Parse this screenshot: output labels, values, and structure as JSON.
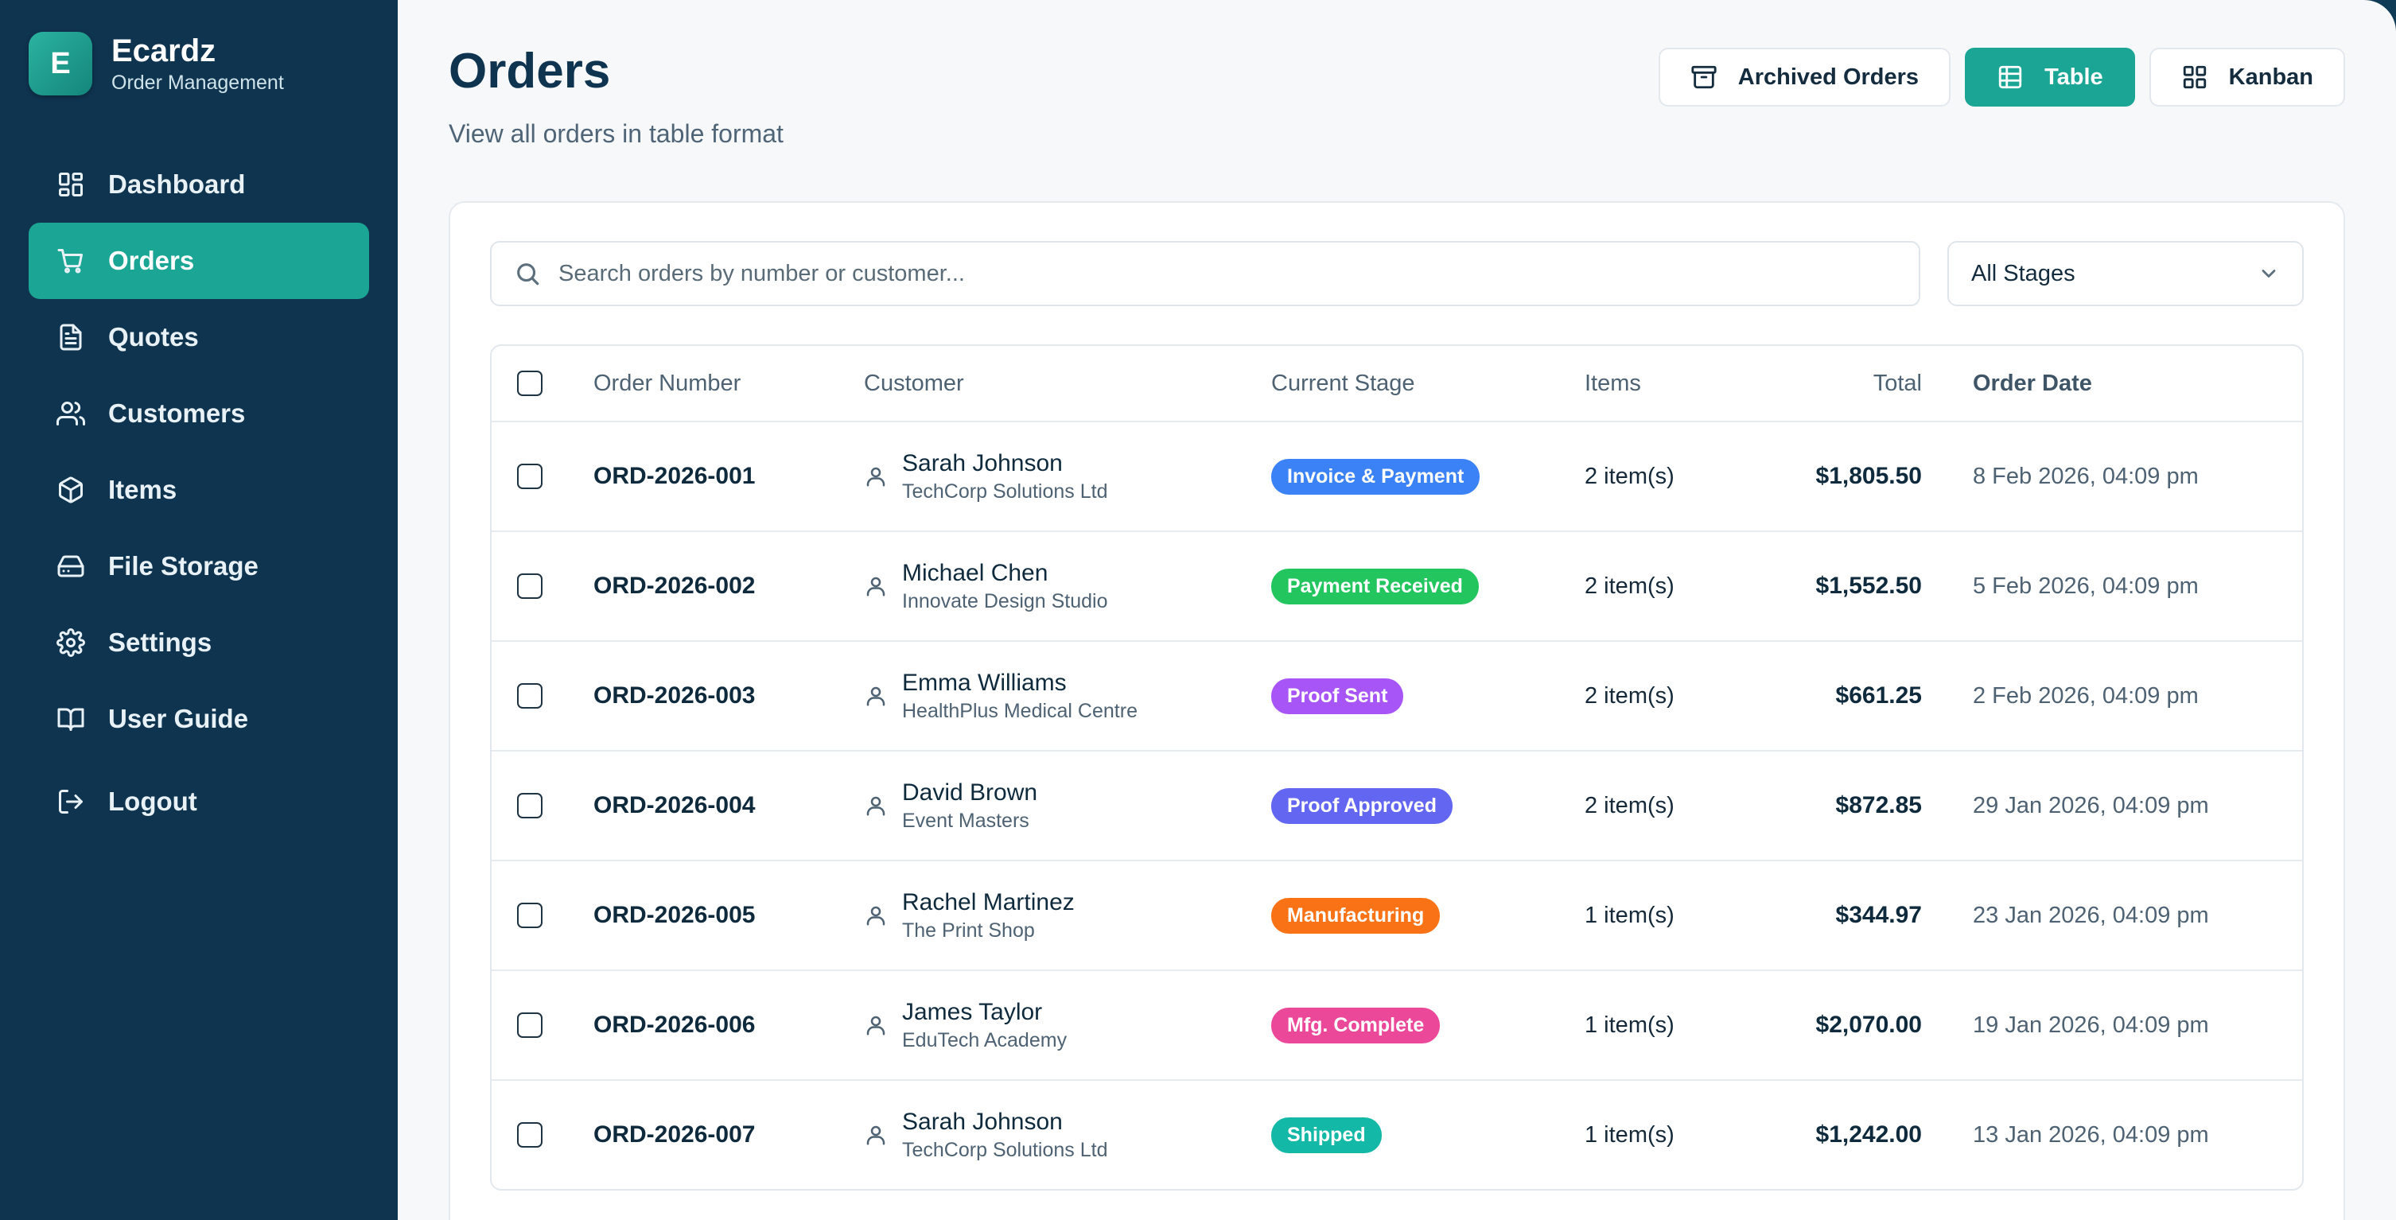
{
  "brand": {
    "logo_letter": "E",
    "name": "Ecardz",
    "subtitle": "Order Management"
  },
  "sidebar": {
    "items": [
      {
        "label": "Dashboard",
        "icon": "dashboard-icon"
      },
      {
        "label": "Orders",
        "icon": "cart-icon",
        "active": true
      },
      {
        "label": "Quotes",
        "icon": "document-icon"
      },
      {
        "label": "Customers",
        "icon": "users-icon"
      },
      {
        "label": "Items",
        "icon": "box-icon"
      },
      {
        "label": "File Storage",
        "icon": "storage-icon"
      },
      {
        "label": "Settings",
        "icon": "gear-icon"
      },
      {
        "label": "User Guide",
        "icon": "book-icon"
      }
    ],
    "logout": "Logout"
  },
  "header": {
    "title": "Orders",
    "subtitle": "View all orders in table format",
    "archived_label": "Archived Orders",
    "table_label": "Table",
    "kanban_label": "Kanban"
  },
  "filters": {
    "search_placeholder": "Search orders by number or customer...",
    "stage_selected": "All Stages"
  },
  "table": {
    "columns": [
      "Order Number",
      "Customer",
      "Current Stage",
      "Items",
      "Total",
      "Order Date"
    ],
    "rows": [
      {
        "number": "ORD-2026-001",
        "customer": "Sarah Johnson",
        "company": "TechCorp Solutions Ltd",
        "stage": "Invoice & Payment",
        "stage_color": "#3b82f6",
        "items": "2 item(s)",
        "total": "$1,805.50",
        "date": "8 Feb 2026, 04:09 pm"
      },
      {
        "number": "ORD-2026-002",
        "customer": "Michael Chen",
        "company": "Innovate Design Studio",
        "stage": "Payment Received",
        "stage_color": "#22c55e",
        "items": "2 item(s)",
        "total": "$1,552.50",
        "date": "5 Feb 2026, 04:09 pm"
      },
      {
        "number": "ORD-2026-003",
        "customer": "Emma Williams",
        "company": "HealthPlus Medical Centre",
        "stage": "Proof Sent",
        "stage_color": "#a855f7",
        "items": "2 item(s)",
        "total": "$661.25",
        "date": "2 Feb 2026, 04:09 pm"
      },
      {
        "number": "ORD-2026-004",
        "customer": "David Brown",
        "company": "Event Masters",
        "stage": "Proof Approved",
        "stage_color": "#6366f1",
        "items": "2 item(s)",
        "total": "$872.85",
        "date": "29 Jan 2026, 04:09 pm"
      },
      {
        "number": "ORD-2026-005",
        "customer": "Rachel Martinez",
        "company": "The Print Shop",
        "stage": "Manufacturing",
        "stage_color": "#f97316",
        "items": "1 item(s)",
        "total": "$344.97",
        "date": "23 Jan 2026, 04:09 pm"
      },
      {
        "number": "ORD-2026-006",
        "customer": "James Taylor",
        "company": "EduTech Academy",
        "stage": "Mfg. Complete",
        "stage_color": "#ec4899",
        "items": "1 item(s)",
        "total": "$2,070.00",
        "date": "19 Jan 2026, 04:09 pm"
      },
      {
        "number": "ORD-2026-007",
        "customer": "Sarah Johnson",
        "company": "TechCorp Solutions Ltd",
        "stage": "Shipped",
        "stage_color": "#14b8a6",
        "items": "1 item(s)",
        "total": "$1,242.00",
        "date": "13 Jan 2026, 04:09 pm"
      }
    ]
  },
  "colors": {
    "sidebar_bg": "#0f3450",
    "accent": "#1aa595",
    "main_bg": "#f6f8fa"
  }
}
